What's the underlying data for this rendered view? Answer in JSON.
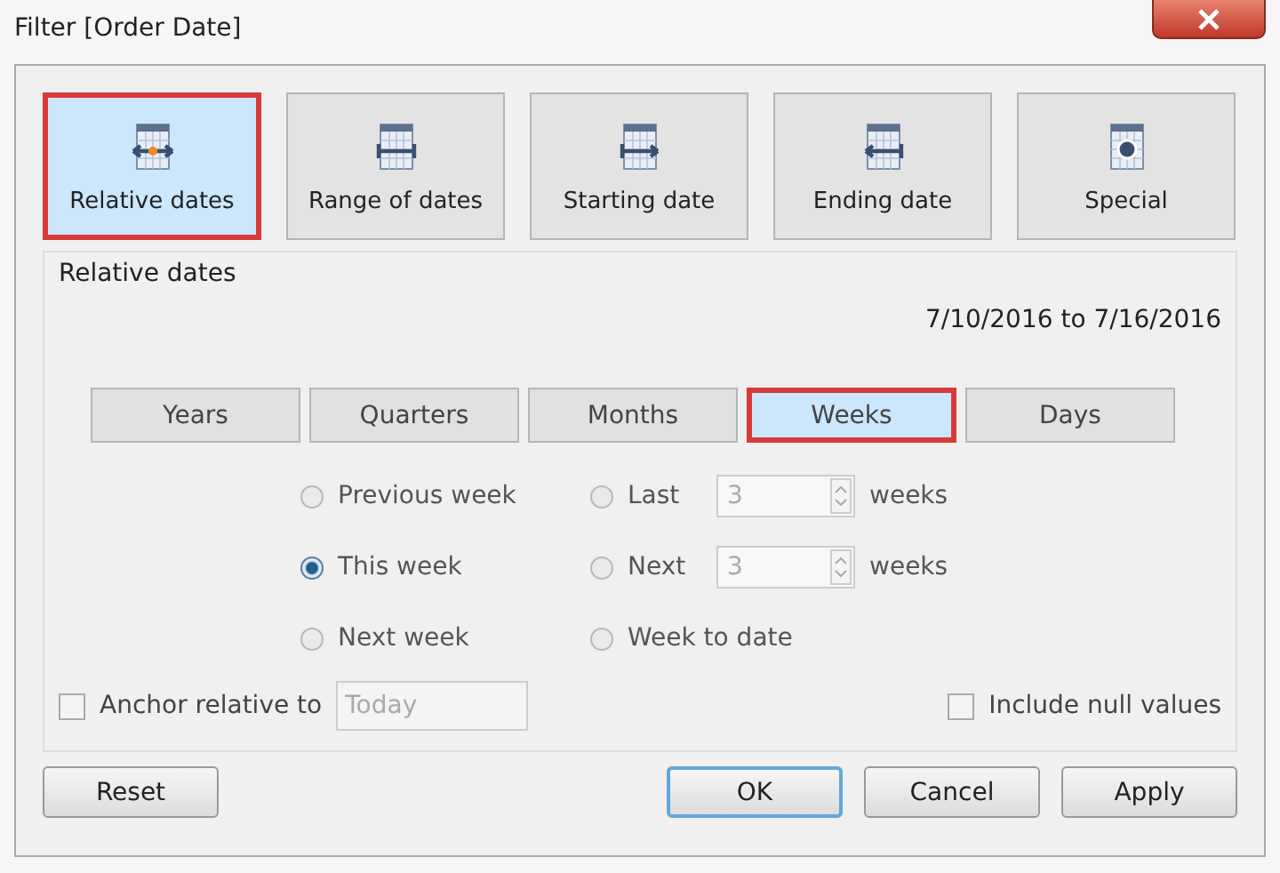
{
  "window": {
    "title": "Filter [Order Date]"
  },
  "modes": [
    {
      "label": "Relative dates",
      "kind": "relative",
      "selected": true
    },
    {
      "label": "Range of dates",
      "kind": "range",
      "selected": false
    },
    {
      "label": "Starting date",
      "kind": "starting",
      "selected": false
    },
    {
      "label": "Ending date",
      "kind": "ending",
      "selected": false
    },
    {
      "label": "Special",
      "kind": "special",
      "selected": false
    }
  ],
  "section_label": "Relative dates",
  "date_range": "7/10/2016 to 7/16/2016",
  "units": [
    {
      "label": "Years",
      "selected": false
    },
    {
      "label": "Quarters",
      "selected": false
    },
    {
      "label": "Months",
      "selected": false
    },
    {
      "label": "Weeks",
      "selected": true
    },
    {
      "label": "Days",
      "selected": false
    }
  ],
  "options": [
    {
      "kind": "plain",
      "label": "Previous week",
      "selected": false
    },
    {
      "kind": "plain",
      "label": "This week",
      "selected": true
    },
    {
      "kind": "plain",
      "label": "Next week",
      "selected": false
    },
    {
      "kind": "spin",
      "label": "Last",
      "value": "3",
      "unit": "weeks",
      "selected": false
    },
    {
      "kind": "spin",
      "label": "Next",
      "value": "3",
      "unit": "weeks",
      "selected": false
    },
    {
      "kind": "plain",
      "label": "Week to date",
      "selected": false
    }
  ],
  "anchor": {
    "label": "Anchor relative to",
    "checked": false,
    "value": "Today"
  },
  "include_null": {
    "label": "Include null values",
    "checked": false
  },
  "buttons": [
    {
      "label": "Reset",
      "default": false
    },
    {
      "label": "OK",
      "default": true
    },
    {
      "label": "Cancel",
      "default": false
    },
    {
      "label": "Apply",
      "default": false
    }
  ]
}
